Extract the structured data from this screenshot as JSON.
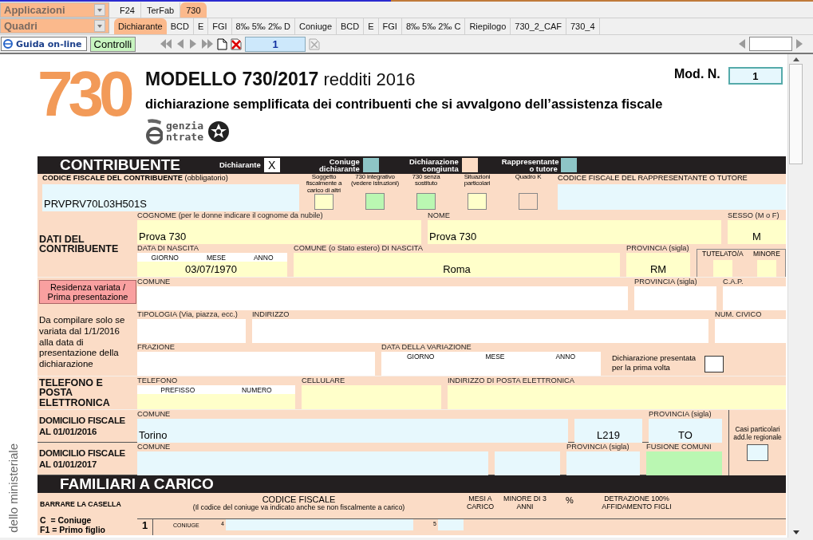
{
  "top_bar": {
    "app_selector": "Applicazioni",
    "app_tabs": [
      {
        "label": "F24",
        "selected": false
      },
      {
        "label": "TerFab",
        "selected": false
      },
      {
        "label": "730",
        "selected": true
      }
    ],
    "section_selector": "Quadri",
    "section_tabs": [
      {
        "label": "Dichiarante",
        "selected": true
      },
      {
        "label": "BCD",
        "selected": false
      },
      {
        "label": "E",
        "selected": false
      },
      {
        "label": "FGI",
        "selected": false
      },
      {
        "label": "8‰ 5‰ 2‰ D",
        "selected": false
      },
      {
        "label": "Coniuge",
        "selected": false
      },
      {
        "label": "BCD",
        "selected": false
      },
      {
        "label": "E",
        "selected": false
      },
      {
        "label": "FGI",
        "selected": false
      },
      {
        "label": "8‰ 5‰ 2‰ C",
        "selected": false
      },
      {
        "label": "Riepilogo",
        "selected": false
      },
      {
        "label": "730_2_CAF",
        "selected": false
      },
      {
        "label": "730_4",
        "selected": false
      }
    ]
  },
  "toolbar": {
    "help_button": "Guida on-line",
    "checks_button": "Controlli",
    "page_field": "1"
  },
  "form": {
    "logo": "730",
    "title": "**MODELLO 730/2017** redditi 2016",
    "subtitle": "dichiarazione semplificata dei contribuenti che si avvalgono dell’assistenza fiscale",
    "agency_lines": [
      "genzia",
      "ntrate"
    ],
    "model_number_label": "Mod. N.",
    "model_number": "1",
    "side_text": "dello ministeriale",
    "contribuente": {
      "title": "CONTRIBUENTE",
      "roles": [
        {
          "label": "Dichiarante",
          "value": "X",
          "color": "#ffffff"
        },
        {
          "label": "Coniuge dichiarante",
          "color": "#8ec5c6"
        },
        {
          "label": "Dichiarazione congiunta",
          "color": "#fcdcc4"
        },
        {
          "label": "Rappresentante o tutore",
          "color": "#8ec5c6"
        }
      ]
    },
    "codice_fiscale": {
      "label": "**CODICE FISCALE DEL CONTRIBUENTE** (obbligatorio)",
      "value": "PRVPRV70L03H501S",
      "flags": [
        {
          "label": "Soggetto fiscalmente a carico di altri",
          "color": "#ffffca",
          "checked": false
        },
        {
          "label": "730 integrativo (vedere istruzioni)",
          "color": "#baf7b2",
          "checked": false
        },
        {
          "label": "730 senza sostituto",
          "color": "#baf7b2",
          "checked": false
        },
        {
          "label": "Situazioni particolari",
          "color": "#ffffca",
          "checked": false
        },
        {
          "label": "Quadro K",
          "color": "#fbdcc6",
          "checked": false
        }
      ],
      "representative_label": "CODICE FISCALE DEL RAPPRESENTANTE O TUTORE"
    },
    "sections": [
      {
        "kind": "dati",
        "label": "DATI DEL CONTRIBUENTE",
        "lines": [
          [
            {
              "kind": "field",
              "label": "COGNOME (per le donne indicare il cognome da nubile)",
              "value": "Prova 730",
              "color": "#ffffca"
            },
            {
              "kind": "field",
              "label": "NOME",
              "value": "Prova 730",
              "color": "#ffffca"
            },
            {
              "kind": "field",
              "label": "SESSO (M o F)",
              "value": "M",
              "color": "#ffffca"
            }
          ],
          [
            {
              "kind": "field",
              "label": "DATA DI NASCITA",
              "parts": [
                "GIORNO",
                "MESE",
                "ANNO"
              ],
              "value": "03/07/1970",
              "color": "#ffffca"
            },
            {
              "kind": "field",
              "label": "COMUNE (o Stato estero) DI NASCITA",
              "value": "Roma",
              "color": "#ffffca"
            },
            {
              "kind": "field",
              "label": "PROVINCIA (sigla)",
              "value": "RM",
              "color": "#ffffca"
            },
            {
              "kind": "boxes",
              "items": [
                {
                  "label": "TUTELATO/A",
                  "checked": false,
                  "color": "#ffffca"
                },
                {
                  "label": "MINORE",
                  "checked": false,
                  "color": "#ffffca"
                }
              ]
            }
          ]
        ]
      },
      {
        "kind": "residenza",
        "button": "Residenza variata / Prima presentazione",
        "note": "Da compilare solo se variata dal 1/1/2016 alla data di presentazione della dichiarazione",
        "lines": [
          [
            {
              "kind": "field",
              "label": "COMUNE",
              "color": "#ffffff"
            },
            {
              "kind": "field",
              "label": "PROVINCIA (sigla)",
              "color": "#ffffff"
            },
            {
              "kind": "field",
              "label": "C.A.P.",
              "color": "#ffffff"
            }
          ],
          [
            {
              "kind": "field",
              "label": "TIPOLOGIA (Via, piazza, ecc.)",
              "color": "#ffffff"
            },
            {
              "kind": "field",
              "label": "INDIRIZZO",
              "color": "#ffffff"
            },
            {
              "kind": "field",
              "label": "NUM. CIVICO",
              "color": "#ffffff"
            }
          ],
          [
            {
              "kind": "field",
              "label": "FRAZIONE",
              "color": "#ffffff"
            },
            {
              "kind": "field",
              "label": "DATA DELLA VARIAZIONE",
              "parts": [
                "GIORNO",
                "MESE",
                "ANNO"
              ],
              "color": "#ffffff"
            },
            {
              "kind": "checkbox",
              "label": "Dichiarazione presentata per la prima volta",
              "checked": false,
              "color": "#ffffff"
            }
          ]
        ]
      },
      {
        "kind": "telefono",
        "label": "TELEFONO E POSTA ELETTRONICA",
        "lines": [
          [
            {
              "kind": "field",
              "label": "TELEFONO",
              "parts": [
                "PREFISSO",
                "NUMERO"
              ],
              "color": "#ffffca"
            },
            {
              "kind": "field",
              "label": "CELLULARE",
              "color": "#ffffca"
            },
            {
              "kind": "field",
              "label": "INDIRIZZO DI POSTA ELETTRONICA",
              "color": "#ffffca"
            }
          ]
        ]
      },
      {
        "kind": "domicilio",
        "side_label": "Casi particolari add.le regionale",
        "side_box": {
          "checked": false,
          "color": "#e7f8fd"
        },
        "rows": [
          {
            "label": "DOMICILIO FISCALE AL 01/01/2016",
            "fields": [
              {
                "kind": "field",
                "label": "COMUNE",
                "value": "Torino",
                "color": "#e7f8fd"
              },
              {
                "kind": "field",
                "value": "L219",
                "color": "#e7f8fd"
              },
              {
                "kind": "field",
                "label": "PROVINCIA (sigla)",
                "value": "TO",
                "color": "#e7f8fd"
              }
            ]
          },
          {
            "label": "DOMICILIO FISCALE AL 01/01/2017",
            "fields": [
              {
                "kind": "field",
                "label": "COMUNE",
                "color": "#e7f8fd"
              },
              {
                "kind": "field",
                "color": "#e7f8fd"
              },
              {
                "kind": "field",
                "label": "PROVINCIA (sigla)",
                "color": "#e7f8fd"
              },
              {
                "kind": "field",
                "label": "FUSIONE COMUNI",
                "color": "#baf7b2"
              }
            ]
          }
        ]
      }
    ],
    "familiari": {
      "title": "FAMILIARI A CARICO",
      "columns": [
        "BARRARE LA CASELLA",
        "CODICE FISCALE",
        "MESI A CARICO",
        "MINORE DI 3 ANNI",
        "%",
        "DETRAZIONE 100% AFFIDAMENTO FIGLI"
      ],
      "codice_note": "(Il codice del coniuge va indicato anche se non fiscalmente a carico)",
      "legend": [
        "C  = Coniuge",
        "F1 = Primo figlio"
      ],
      "row": {
        "number": "1",
        "relation": "CONIUGE",
        "code_mark": "4",
        "months_mark": "5"
      }
    }
  }
}
